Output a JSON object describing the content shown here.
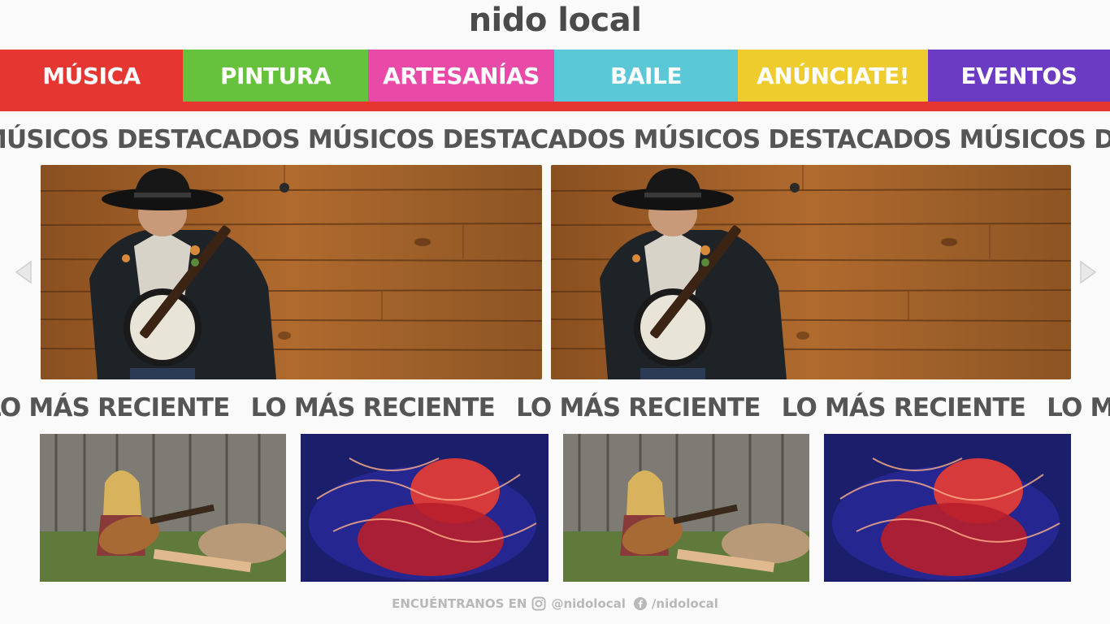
{
  "header": {
    "title": "nido local"
  },
  "nav": {
    "items": [
      {
        "label": "MÚSICA",
        "color": "#e63632"
      },
      {
        "label": "PINTURA",
        "color": "#66c23c"
      },
      {
        "label": "ARTESANÍAS",
        "color": "#ea4aa7"
      },
      {
        "label": "BAILE",
        "color": "#5bc8d8"
      },
      {
        "label": "ANÚNCIATE!",
        "color": "#efcc2e"
      },
      {
        "label": "EVENTOS",
        "color": "#6c3bc4"
      }
    ]
  },
  "featured": {
    "heading": "MÚSICOS DESTACADOS",
    "prev_icon": "chevron-left-icon",
    "next_icon": "chevron-right-icon"
  },
  "recent": {
    "heading": "LO MÁS RECIENTE"
  },
  "footer": {
    "find_us": "ENCUÉNTRANOS EN",
    "instagram_handle": "@nidolocal",
    "facebook_handle": "/nidolocal"
  },
  "colors": {
    "background": "#fafafa",
    "text": "#4b4b4b",
    "footer_text": "#b8b8b8",
    "nav_underline": "#e63632"
  }
}
